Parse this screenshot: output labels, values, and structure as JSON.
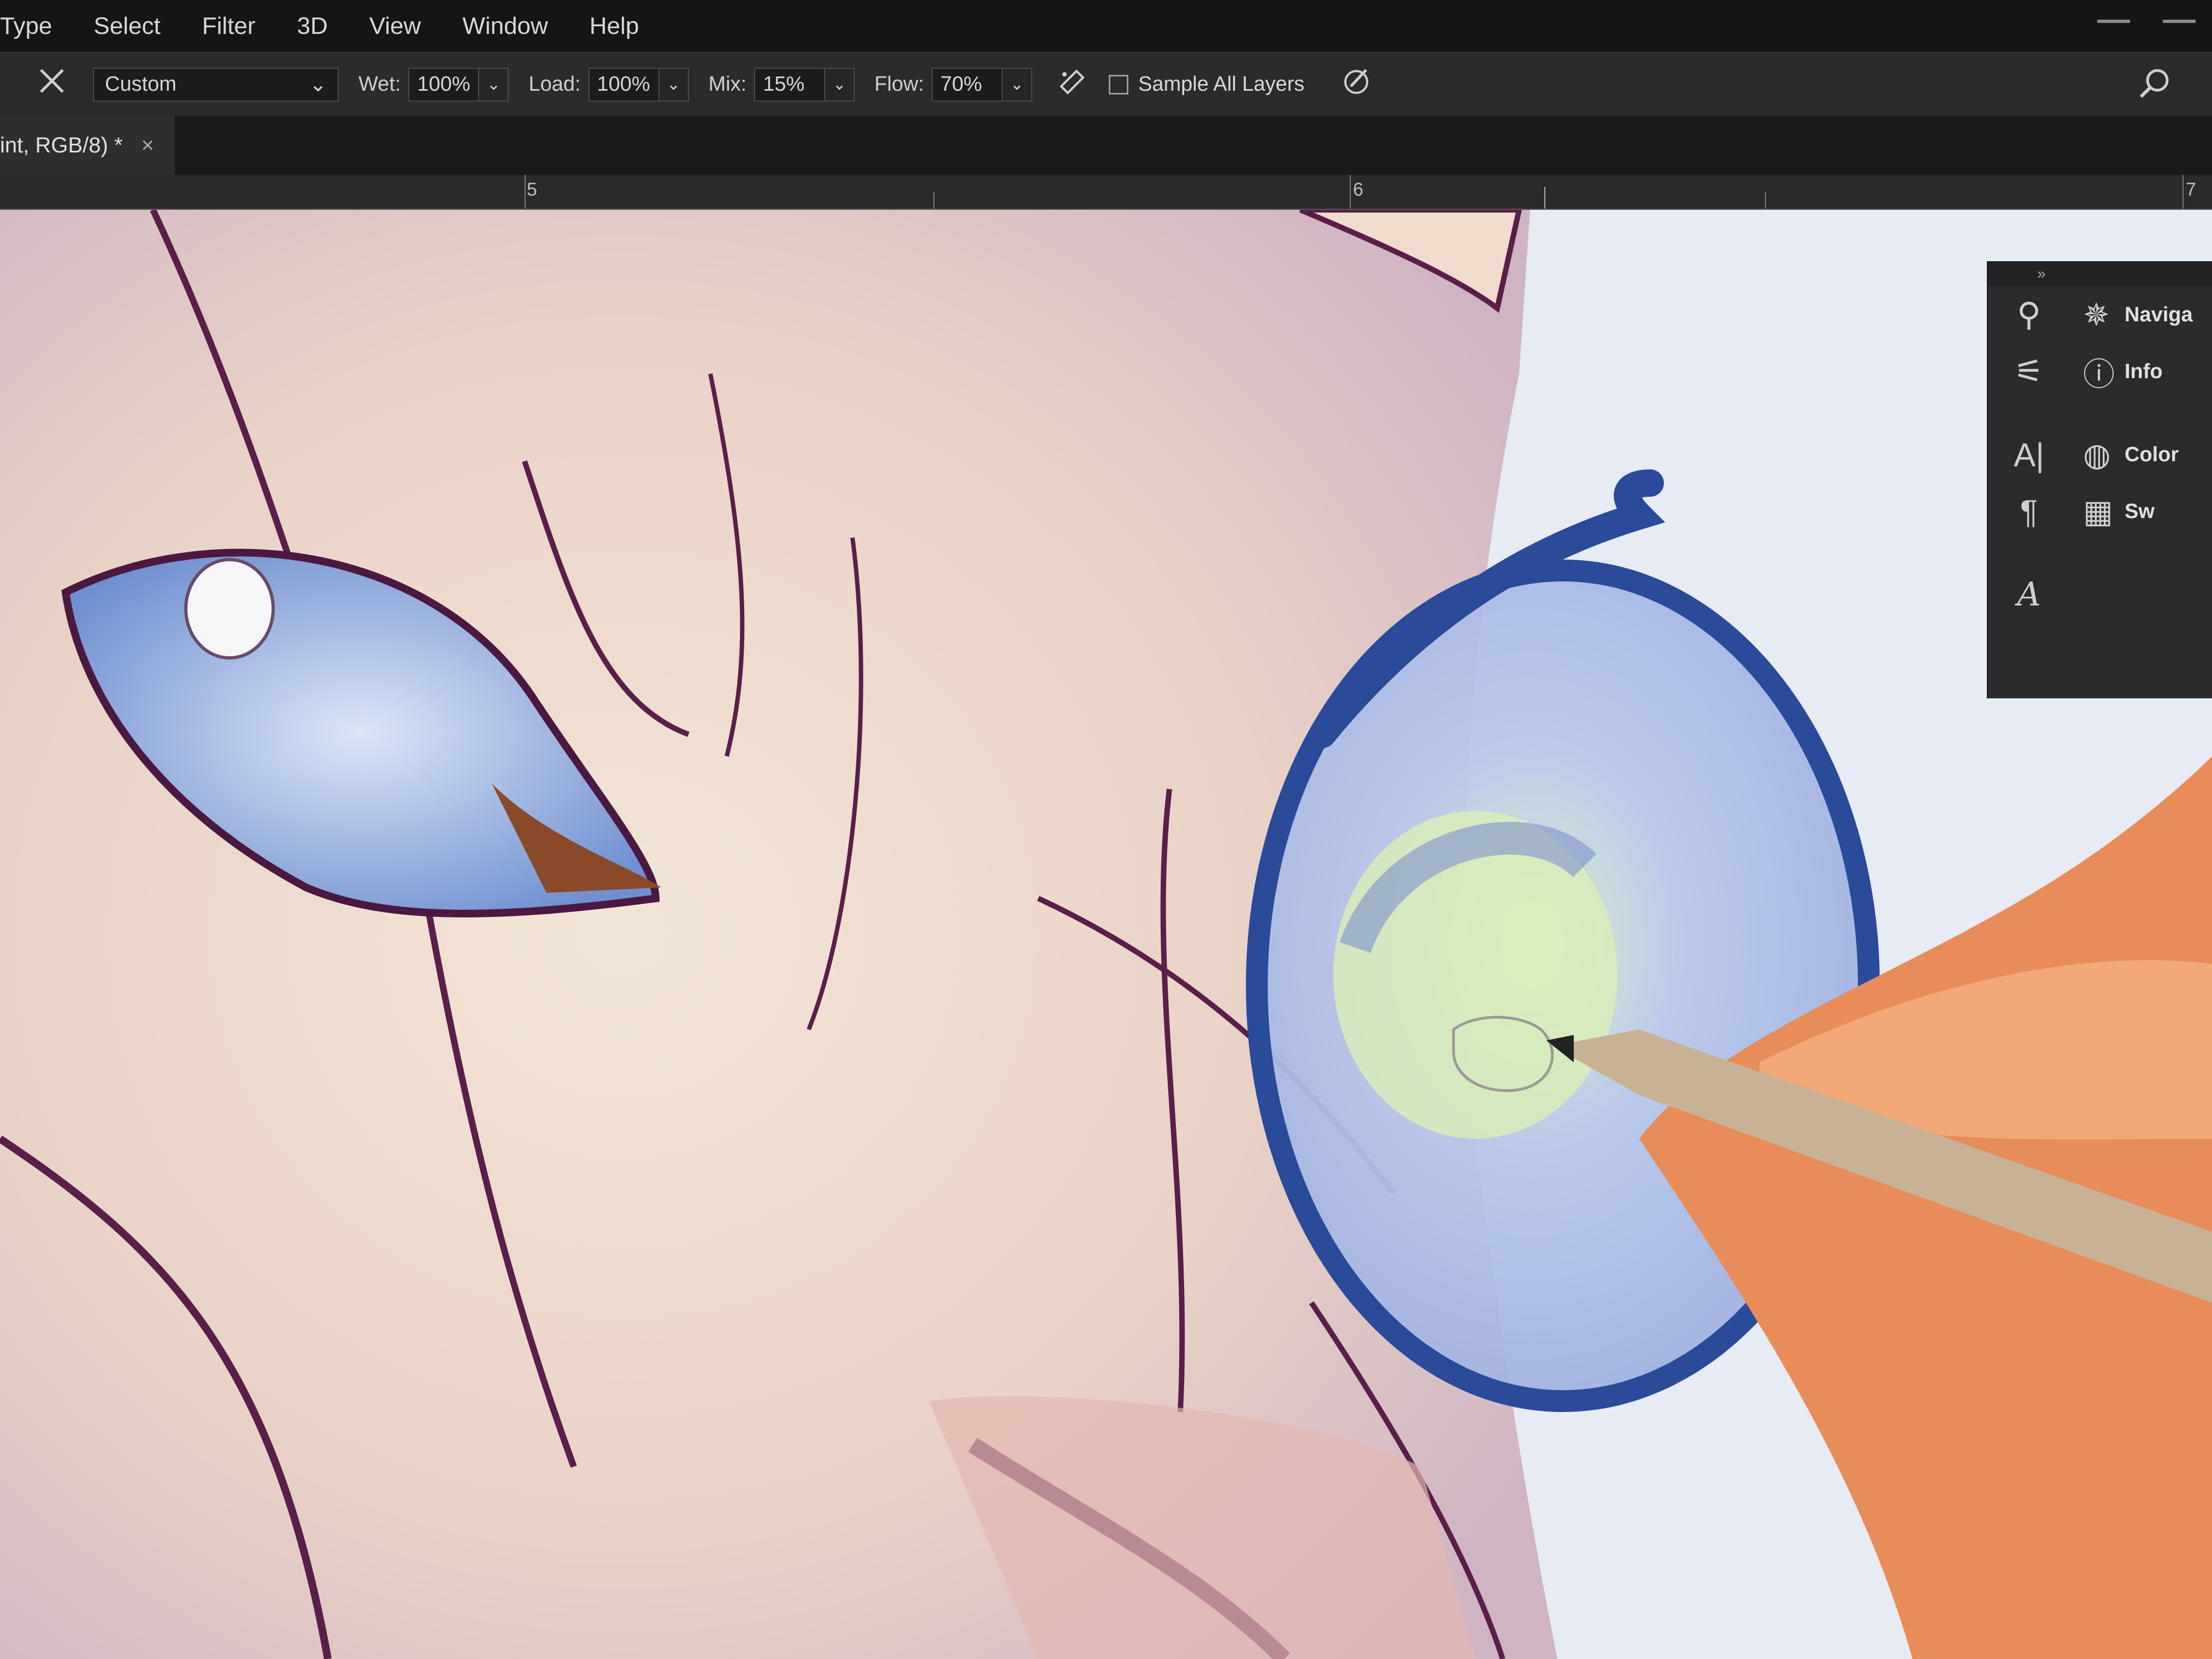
{
  "menubar": {
    "items": [
      "Type",
      "Select",
      "Filter",
      "3D",
      "View",
      "Window",
      "Help"
    ]
  },
  "options": {
    "brush_preset": "Custom",
    "wet": {
      "label": "Wet:",
      "value": "100%"
    },
    "load": {
      "label": "Load:",
      "value": "100%"
    },
    "mix": {
      "label": "Mix:",
      "value": "15%"
    },
    "flow": {
      "label": "Flow:",
      "value": "70%"
    },
    "sample_all_layers": {
      "label": "Sample All Layers",
      "checked": false
    }
  },
  "document_tab": {
    "title": "int, RGB/8) *",
    "close": "×"
  },
  "ruler": {
    "numbers": [
      "5",
      "6",
      "7"
    ]
  },
  "panels": {
    "collapse": "»",
    "items": [
      {
        "label": "Naviga",
        "icon": "navigator-icon"
      },
      {
        "label": "Info",
        "icon": "info-icon"
      },
      {
        "label": "Color",
        "icon": "color-palette-icon"
      },
      {
        "label": "Sw",
        "icon": "swatches-grid-icon"
      }
    ]
  },
  "colors": {
    "menubar_bg": "#151515",
    "optionsbar_bg": "#2b2b2b",
    "panel_bg": "#2b2b2b",
    "canvas_bg": "#e7ebf3"
  }
}
